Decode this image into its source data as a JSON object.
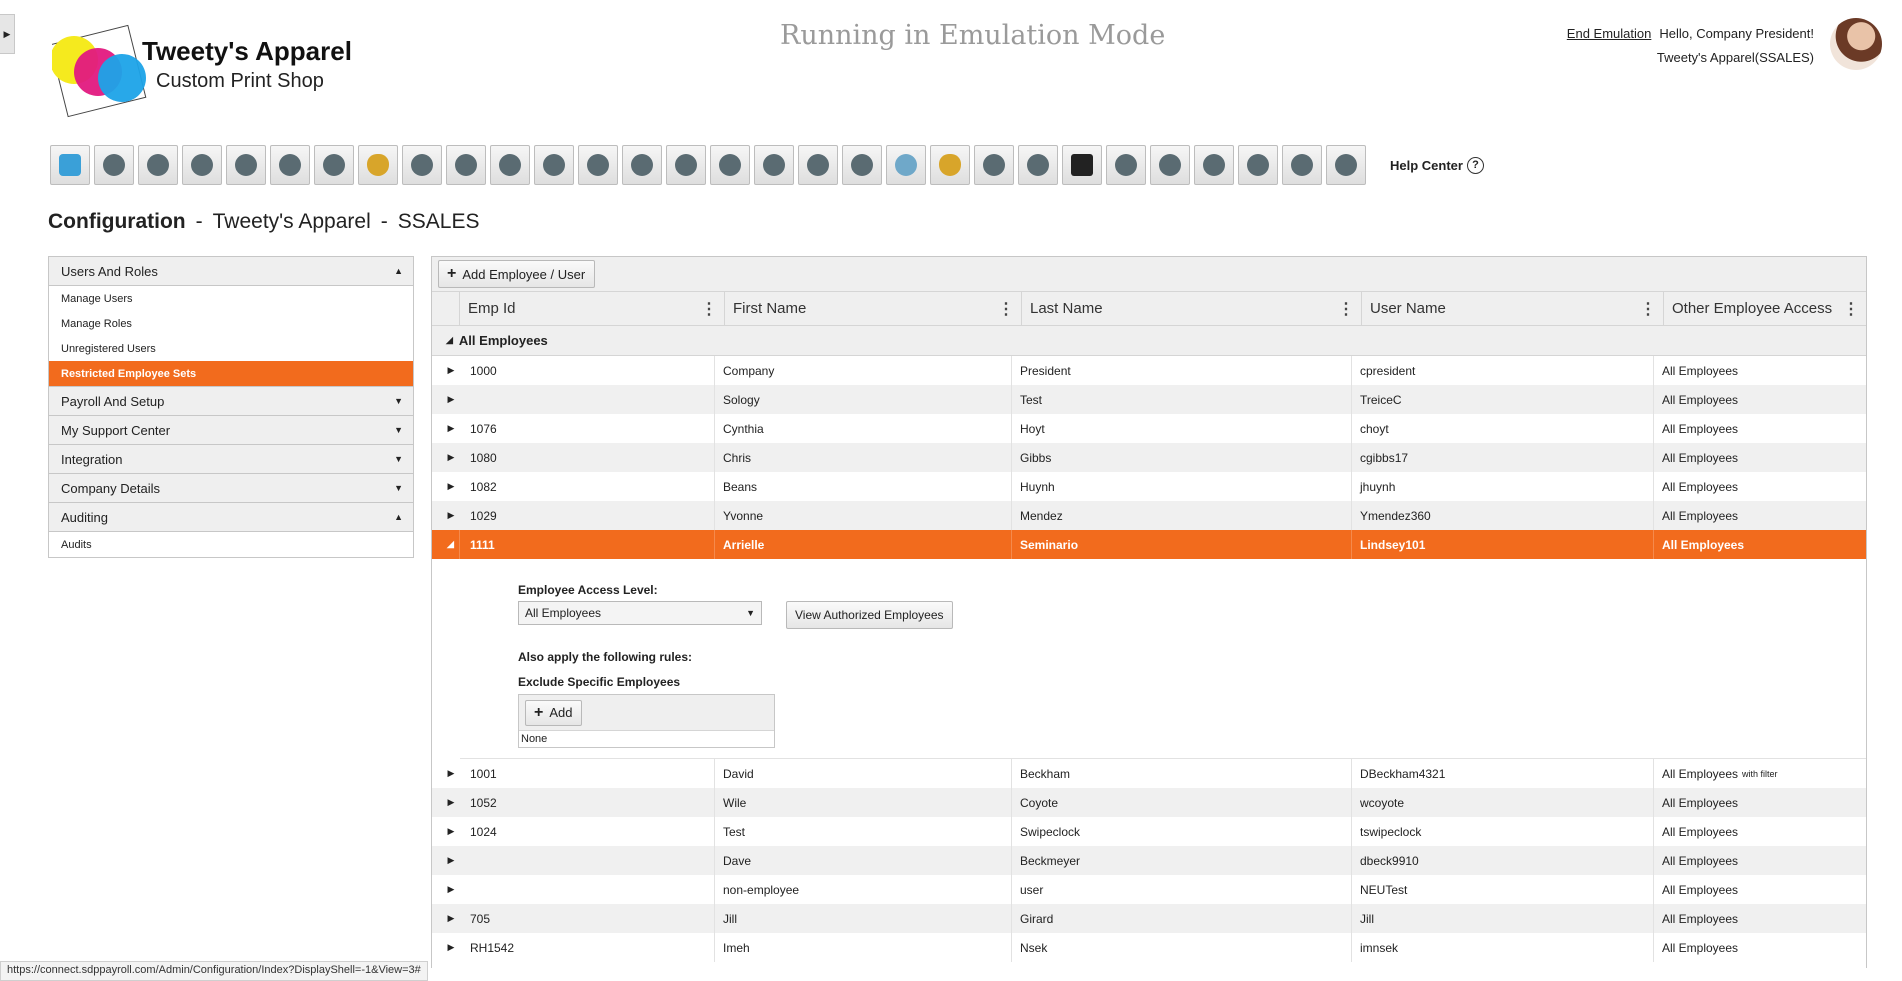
{
  "brand": {
    "name": "Tweety's Apparel",
    "tagline": "Custom Print Shop"
  },
  "banner": "Running in Emulation Mode",
  "user": {
    "end_emulation": "End Emulation",
    "greeting": "Hello, Company President!",
    "company": "Tweety's Apparel(SSALES)"
  },
  "toolbar": {
    "icons": [
      "home-icon",
      "award-icon",
      "people-gear-icon",
      "funnel-icon",
      "team-icon",
      "org-chart-icon",
      "edit-doc-icon",
      "money-bag-icon",
      "search-person-icon",
      "target-icon",
      "target-icon",
      "growth-chart-icon",
      "target-icon",
      "sort-icon",
      "user-star-icon",
      "shield-icon",
      "user-tie-icon",
      "sort-icon",
      "user-remove-icon",
      "fingerprint-icon",
      "money-bag-icon",
      "user-star-icon",
      "hierarchy-icon",
      "clipboard-plus-icon",
      "shield-icon",
      "hand-money-icon",
      "gift-icon",
      "document-icon",
      "group-board-icon",
      "certificate-icon"
    ],
    "help_label": "Help Center",
    "help_glyph": "?"
  },
  "title": {
    "section": "Configuration",
    "sep1": "-",
    "company": "Tweety's Apparel",
    "sep2": "-",
    "code": "SSALES"
  },
  "sidebar": {
    "groups": [
      {
        "label": "Users And Roles",
        "arrow": "▲"
      },
      {
        "label": "Payroll And Setup",
        "arrow": "▼"
      },
      {
        "label": "My Support Center",
        "arrow": "▼"
      },
      {
        "label": "Integration",
        "arrow": "▼"
      },
      {
        "label": "Company Details",
        "arrow": "▼"
      },
      {
        "label": "Auditing",
        "arrow": "▲"
      }
    ],
    "users_items": [
      "Manage Users",
      "Manage Roles",
      "Unregistered Users",
      "Restricted Employee Sets"
    ],
    "auditing_items": [
      "Audits"
    ]
  },
  "grid": {
    "add_button": "Add Employee / User",
    "columns": [
      "Emp Id",
      "First Name",
      "Last Name",
      "User Name",
      "Other Employee Access"
    ],
    "group_label": "All Employees",
    "rows_before": [
      {
        "emp_id": "1000",
        "first": "Company",
        "last": "President",
        "user": "cpresident",
        "access": "All Employees",
        "note": ""
      },
      {
        "emp_id": "",
        "first": "Sology",
        "last": "Test",
        "user": "TreiceC",
        "access": "All Employees",
        "note": ""
      },
      {
        "emp_id": "1076",
        "first": "Cynthia",
        "last": "Hoyt",
        "user": "choyt",
        "access": "All Employees",
        "note": ""
      },
      {
        "emp_id": "1080",
        "first": "Chris",
        "last": "Gibbs",
        "user": "cgibbs17",
        "access": "All Employees",
        "note": ""
      },
      {
        "emp_id": "1082",
        "first": "Beans",
        "last": "Huynh",
        "user": "jhuynh",
        "access": "All Employees",
        "note": ""
      },
      {
        "emp_id": "1029",
        "first": "Yvonne",
        "last": "Mendez",
        "user": "Ymendez360",
        "access": "All Employees",
        "note": ""
      }
    ],
    "selected": {
      "emp_id": "1111",
      "first": "Arrielle",
      "last": "Seminario",
      "user": "Lindsey101",
      "access": "All Employees"
    },
    "detail": {
      "access_level_label": "Employee Access Level:",
      "access_level_value": "All Employees",
      "view_button": "View Authorized Employees",
      "rules_label": "Also apply the following rules:",
      "exclude_label": "Exclude Specific Employees",
      "add_button": "Add",
      "none_text": "None"
    },
    "rows_after": [
      {
        "emp_id": "1001",
        "first": "David",
        "last": "Beckham",
        "user": "DBeckham4321",
        "access": "All Employees",
        "note": "with filter"
      },
      {
        "emp_id": "1052",
        "first": "Wile",
        "last": "Coyote",
        "user": "wcoyote",
        "access": "All Employees",
        "note": ""
      },
      {
        "emp_id": "1024",
        "first": "Test",
        "last": "Swipeclock",
        "user": "tswipeclock",
        "access": "All Employees",
        "note": ""
      },
      {
        "emp_id": "",
        "first": "Dave",
        "last": "Beckmeyer",
        "user": "dbeck9910",
        "access": "All Employees",
        "note": ""
      },
      {
        "emp_id": "",
        "first": "non-employee",
        "last": "user",
        "user": "NEUTest",
        "access": "All Employees",
        "note": ""
      },
      {
        "emp_id": "705",
        "first": "Jill",
        "last": "Girard",
        "user": "Jill",
        "access": "All Employees",
        "note": ""
      },
      {
        "emp_id": "RH1542",
        "first": "Imeh",
        "last": "Nsek",
        "user": "imnsek",
        "access": "All Employees",
        "note": ""
      }
    ]
  },
  "status_url": "https://connect.sdppayroll.com/Admin/Configuration/Index?DisplayShell=-1&View=3#",
  "colors": {
    "accent": "#f26b1d",
    "banner": "#9a9a9a",
    "panel": "#efefef"
  }
}
